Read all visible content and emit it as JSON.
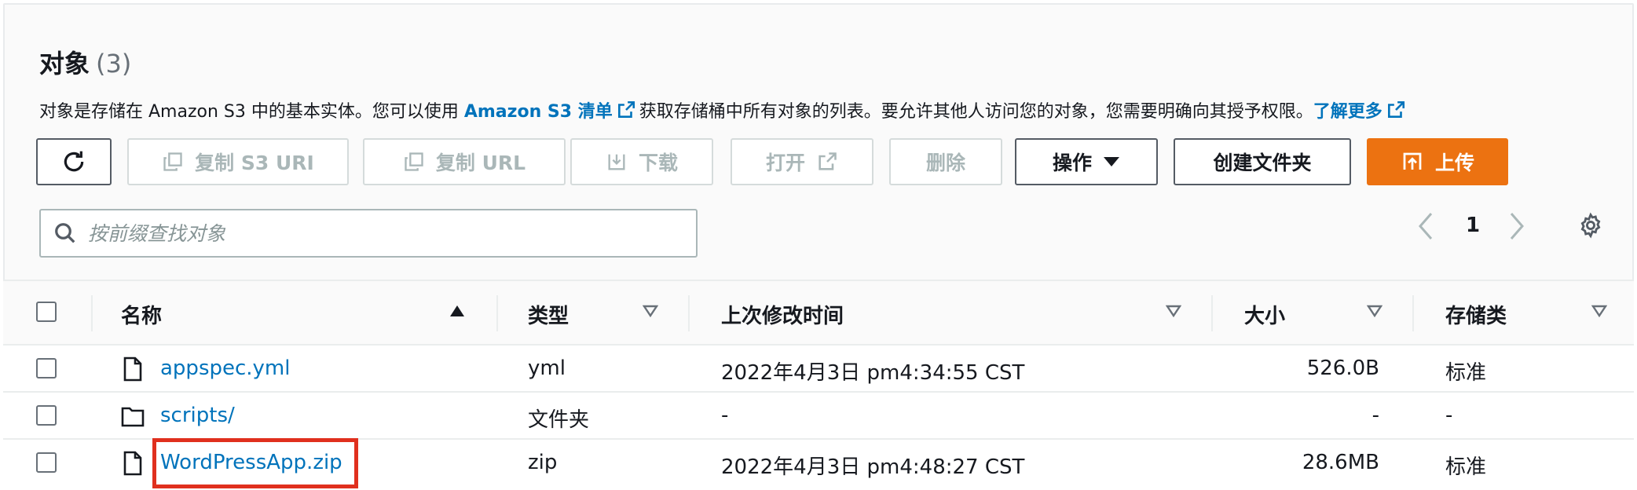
{
  "header": {
    "title": "对象",
    "count": "(3)"
  },
  "description": {
    "part1": "对象是存储在 Amazon S3 中的基本实体。您可以使用 ",
    "link1": "Amazon S3 清单",
    "part2": "获取存储桶中所有对象的列表。要允许其他人访问您的对象，您需要明确向其授予权限。",
    "link2": "了解更多"
  },
  "toolbar": {
    "copy_s3_uri": "复制 S3 URI",
    "copy_url": "复制 URL",
    "download": "下载",
    "open": "打开",
    "delete": "删除",
    "actions": "操作",
    "create_folder": "创建文件夹",
    "upload": "上传"
  },
  "search": {
    "placeholder": "按前缀查找对象"
  },
  "pagination": {
    "page": "1"
  },
  "table": {
    "headers": {
      "name": "名称",
      "type": "类型",
      "last_modified": "上次修改时间",
      "size": "大小",
      "storage_class": "存储类"
    },
    "rows": [
      {
        "name": "appspec.yml",
        "icon": "file-icon",
        "type": "yml",
        "last_modified": "2022年4月3日 pm4:34:55 CST",
        "size": "526.0B",
        "storage_class": "标准"
      },
      {
        "name": "scripts/",
        "icon": "folder-icon",
        "type": "文件夹",
        "last_modified": "-",
        "size": "-",
        "storage_class": "-"
      },
      {
        "name": "WordPressApp.zip",
        "icon": "file-icon",
        "type": "zip",
        "last_modified": "2022年4月3日 pm4:48:27 CST",
        "size": "28.6MB",
        "storage_class": "标准"
      }
    ]
  },
  "colors": {
    "link": "#0073bb",
    "primary": "#ec7211",
    "highlight": "#e0301e"
  }
}
